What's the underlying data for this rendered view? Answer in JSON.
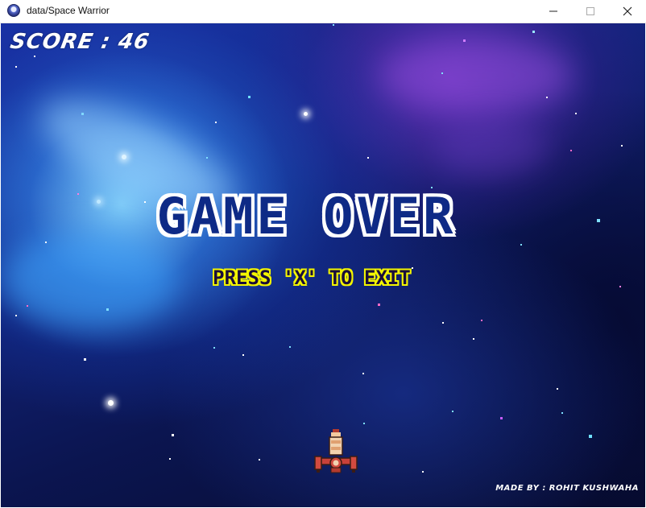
{
  "window": {
    "title": "data/Space Warrior",
    "app_icon": "space-warrior-app-icon",
    "controls": [
      "minimize-icon",
      "maximize-icon",
      "close-icon"
    ]
  },
  "hud": {
    "score_text": "SCORE : 46",
    "score_value": 46
  },
  "overlay": {
    "headline": "GAME OVER",
    "hint": "PRESS 'X' TO EXIT",
    "hint_color": "#f3f500",
    "headline_color": "#0e2a86"
  },
  "footer": {
    "credit": "MADE BY : ROHIT KUSHWAHA"
  },
  "player": {
    "sprite": "spaceship-icon"
  },
  "colors": {
    "space_dark": "#070b2e",
    "space_blue": "#1b2fa0",
    "nebula_cyan": "#8cdcff",
    "nebula_purple": "#6e32be"
  }
}
